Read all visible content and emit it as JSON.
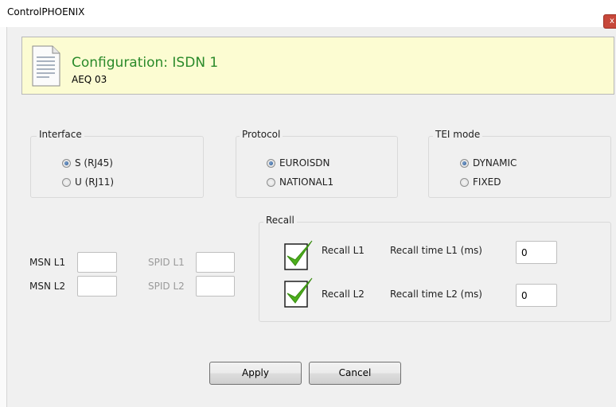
{
  "window": {
    "title": "ControlPHOENIX",
    "close_label": "x"
  },
  "header": {
    "title": "Configuration: ISDN 1",
    "subtitle": "AEQ 03"
  },
  "interface": {
    "legend": "Interface",
    "options": [
      {
        "label": "S (RJ45)",
        "selected": true
      },
      {
        "label": "U (RJ11)",
        "selected": false
      }
    ]
  },
  "protocol": {
    "legend": "Protocol",
    "options": [
      {
        "label": "EUROISDN",
        "selected": true
      },
      {
        "label": "NATIONAL1",
        "selected": false
      }
    ]
  },
  "tei": {
    "legend": "TEI mode",
    "options": [
      {
        "label": "DYNAMIC",
        "selected": true
      },
      {
        "label": "FIXED",
        "selected": false
      }
    ]
  },
  "numbers": {
    "msn_l1_label": "MSN L1",
    "msn_l1_value": "",
    "msn_l2_label": "MSN L2",
    "msn_l2_value": "",
    "spid_l1_label": "SPID L1",
    "spid_l1_value": "",
    "spid_l2_label": "SPID L2",
    "spid_l2_value": ""
  },
  "recall": {
    "legend": "Recall",
    "l1_label": "Recall L1",
    "l1_checked": true,
    "l1_time_label": "Recall time L1 (ms)",
    "l1_time_value": "0",
    "l2_label": "Recall L2",
    "l2_checked": true,
    "l2_time_label": "Recall time L2 (ms)",
    "l2_time_value": "0"
  },
  "buttons": {
    "apply": "Apply",
    "cancel": "Cancel"
  },
  "colors": {
    "header_bg": "#fcfcd2",
    "header_title": "#2a8a2a",
    "check_green": "#4cae1c"
  }
}
